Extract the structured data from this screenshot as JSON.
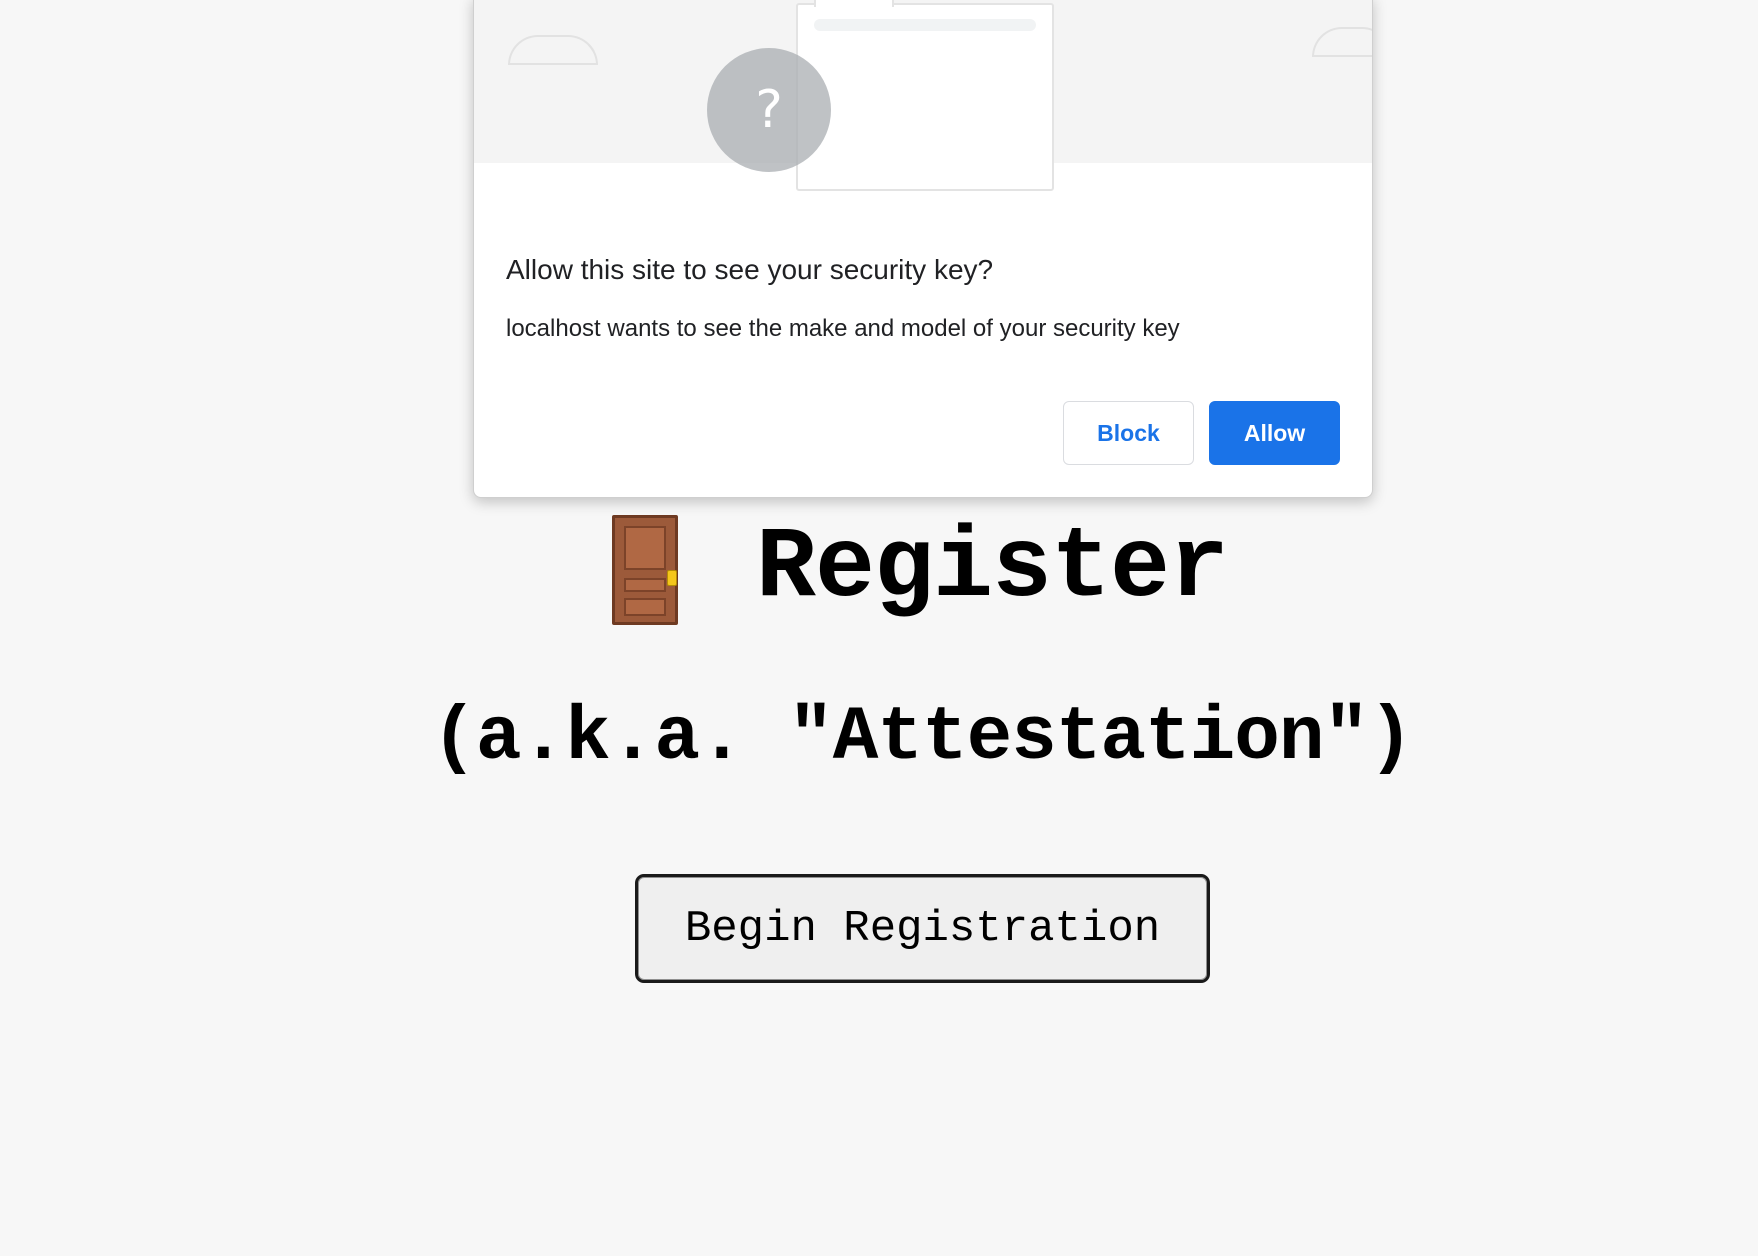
{
  "dialog": {
    "title": "Allow this site to see your security key?",
    "message": "localhost wants to see the make and model of your security key",
    "illustration_icon": "question-mark-icon",
    "illustration_symbol": "?",
    "block_label": "Block",
    "allow_label": "Allow"
  },
  "page": {
    "heading_icon": "door-icon",
    "heading": "Register",
    "subheading": "(a.k.a. \"Attestation\")",
    "begin_button_label": "Begin Registration"
  },
  "colors": {
    "accent": "#1a73e8",
    "page_background": "#f7f7f7",
    "dialog_background": "#ffffff"
  }
}
